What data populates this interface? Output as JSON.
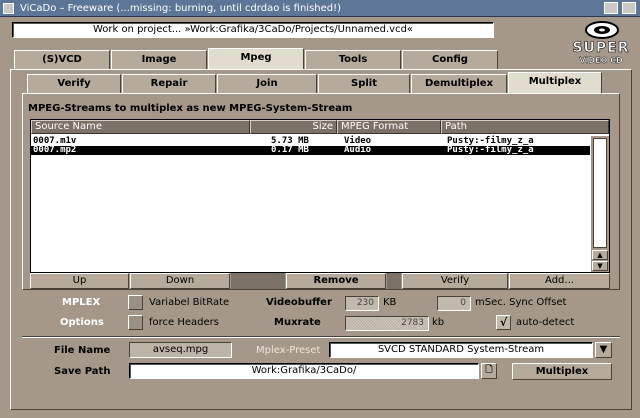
{
  "window": {
    "title": "ViCaDo  –  Freeware (...missing: burning, until cdrdao is finished!)"
  },
  "status_text": "Work on project... »Work:Grafika/3CaDo/Projects/Unnamed.vcd«",
  "logo": {
    "line1": "SUPER",
    "line2": "VIDEO CD"
  },
  "main_tabs": [
    "(S)VCD",
    "Image",
    "Mpeg",
    "Tools",
    "Config"
  ],
  "main_tab_selected": "Mpeg",
  "sub_tabs": [
    "Verify",
    "Repair",
    "Join",
    "Split",
    "Demultiplex",
    "Multiplex"
  ],
  "sub_tab_selected": "Multiplex",
  "multiplex": {
    "group_title": "MPEG-Streams to multiplex as new MPEG-System-Stream",
    "columns": [
      "Source Name",
      "Size",
      "MPEG Format",
      "Path"
    ],
    "rows": [
      {
        "source": "0007.m1v",
        "size": "5.73 MB",
        "format": "Video",
        "path": "Pusty:-filmy_z_a"
      },
      {
        "source": "0007.mp2",
        "size": "0.17 MB",
        "format": "Audio",
        "path": "Pusty:-filmy_z_a"
      }
    ],
    "buttons": {
      "up": "Up",
      "down": "Down",
      "remove": "Remove",
      "verify": "Verify",
      "add": "Add..."
    }
  },
  "options": {
    "mplex_label": "MPLEX",
    "options_label": "Options",
    "variabel_bitrate": "Variabel BitRate",
    "force_headers": "force Headers",
    "videobuffer_label": "Videobuffer",
    "videobuffer_value": "230",
    "videobuffer_unit": "KB",
    "sync_offset_value": "0",
    "sync_offset_label": "mSec. Sync Offset",
    "muxrate_label": "Muxrate",
    "muxrate_value": "2783",
    "muxrate_unit": "kb",
    "auto_detect": "auto-detect",
    "auto_detect_checked": "√"
  },
  "output": {
    "file_name_label": "File Name",
    "file_name": "avseq.mpg",
    "preset_label": "Mplex-Preset",
    "preset_value": "SVCD   STANDARD System-Stream",
    "save_path_label": "Save Path",
    "save_path": "Work:Grafika/3CaDo/",
    "multiplex_button": "Multiplex"
  }
}
